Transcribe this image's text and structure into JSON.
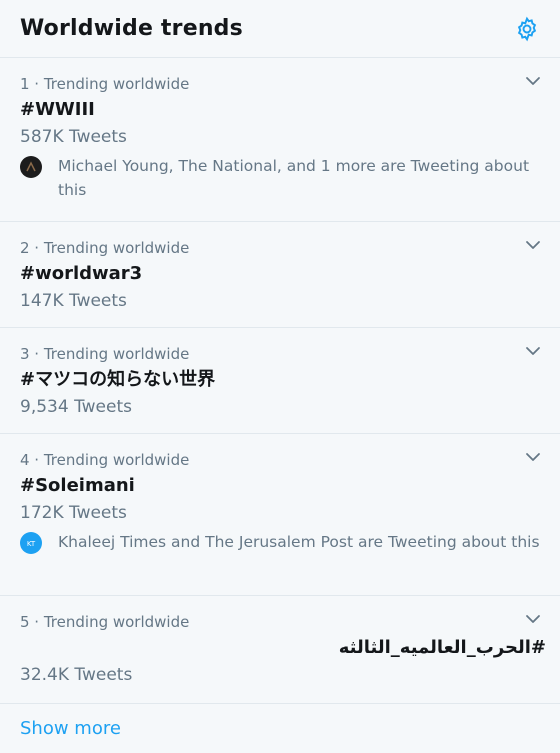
{
  "header": {
    "title": "Worldwide trends",
    "settings_icon": "gear-icon"
  },
  "trends": [
    {
      "meta": "1 · Trending worldwide",
      "name": "#WWIII",
      "count": "587K Tweets",
      "context": "Michael Young, The National, and 1 more are Tweeting about this"
    },
    {
      "meta": "2 · Trending worldwide",
      "name": "#worldwar3",
      "count": "147K Tweets"
    },
    {
      "meta": "3 · Trending worldwide",
      "name": "#マツコの知らない世界",
      "count": "9,534 Tweets"
    },
    {
      "meta": "4 · Trending worldwide",
      "name": "#Soleimani",
      "count": "172K Tweets",
      "context": "Khaleej Times and The Jerusalem Post are Tweeting about this"
    },
    {
      "meta": "5 · Trending worldwide",
      "name": "#الحرب_العالميه_الثالثه",
      "count": "32.4K Tweets"
    }
  ],
  "show_more": "Show more",
  "colors": {
    "accent": "#1da1f2",
    "secondary_text": "#657786",
    "background": "#f5f8fa"
  }
}
